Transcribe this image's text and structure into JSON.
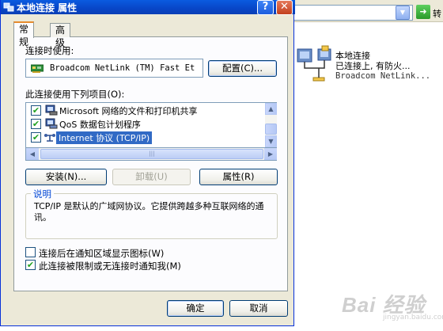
{
  "background": {
    "address_go_label": "转",
    "network_item": {
      "name": "本地连接",
      "status": "已连接上, 有防火...",
      "device": "Broadcom NetLink..."
    },
    "watermark": "Bai 经验",
    "watermark_sub": "jingyan.baidu.com"
  },
  "dialog": {
    "title": "本地连接 属性",
    "help_glyph": "?",
    "close_glyph": "✕",
    "tabs": [
      {
        "label": "常规",
        "active": true
      },
      {
        "label": "高级",
        "active": false
      }
    ],
    "connect_using_label": "连接时使用:",
    "adapter_name": "Broadcom NetLink (TM) Fast Et",
    "configure_button": "配置(C)...",
    "items_label": "此连接使用下列项目(O):",
    "components": [
      {
        "label": "Microsoft 网络的文件和打印机共享",
        "checked": true,
        "icon": "printer-share-icon",
        "selected": false
      },
      {
        "label": "QoS 数据包计划程序",
        "checked": true,
        "icon": "qos-scheduler-icon",
        "selected": false
      },
      {
        "label": "Internet 协议 (TCP/IP)",
        "checked": true,
        "icon": "protocol-icon",
        "selected": true
      }
    ],
    "install_button": "安装(N)...",
    "uninstall_button": "卸载(U)",
    "properties_button": "属性(R)",
    "description_title": "说明",
    "description_text": "TCP/IP 是默认的广域网协议。它提供跨越多种互联网络的通讯。",
    "options": [
      {
        "label": "连接后在通知区域显示图标(W)",
        "checked": false
      },
      {
        "label": "此连接被限制或无连接时通知我(M)",
        "checked": true
      }
    ],
    "ok_button": "确定",
    "cancel_button": "取消",
    "colors": {
      "titlebar": "#0a5be0",
      "selection": "#316ac5",
      "group_title": "#0046d5",
      "check": "#21a121"
    }
  }
}
